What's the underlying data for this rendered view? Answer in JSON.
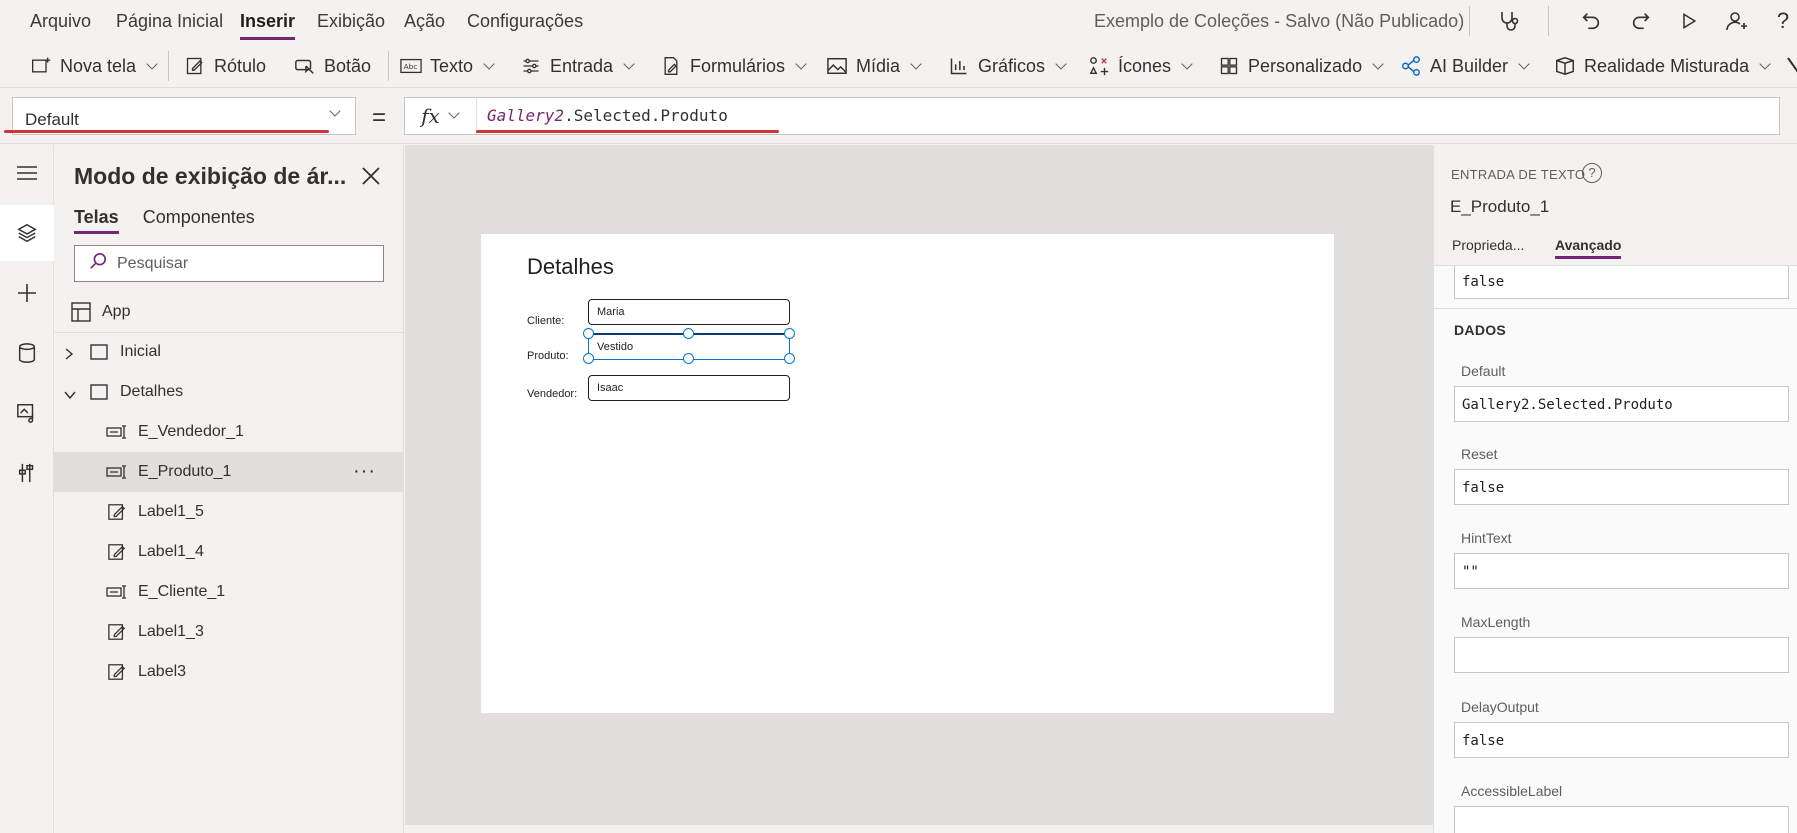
{
  "menubar": {
    "items": [
      "Arquivo",
      "Página Inicial",
      "Inserir",
      "Exibição",
      "Ação",
      "Configurações"
    ],
    "active": "Inserir",
    "app_title": "Exemplo de Coleções - Salvo (Não Publicado)",
    "icons": [
      "stethoscope-icon",
      "undo-icon",
      "redo-icon",
      "play-icon",
      "share-user-icon",
      "help-icon"
    ]
  },
  "ribbon": {
    "items": [
      {
        "label": "Nova tela",
        "icon": "new-screen-icon",
        "dropdown": true
      },
      {
        "label": "Rótulo",
        "icon": "label-edit-icon",
        "dropdown": false
      },
      {
        "label": "Botão",
        "icon": "button-icon",
        "dropdown": false
      },
      {
        "label": "Texto",
        "icon": "text-icon",
        "dropdown": true
      },
      {
        "label": "Entrada",
        "icon": "input-sliders-icon",
        "dropdown": true
      },
      {
        "label": "Formulários",
        "icon": "form-icon",
        "dropdown": true
      },
      {
        "label": "Mídia",
        "icon": "image-icon",
        "dropdown": true
      },
      {
        "label": "Gráficos",
        "icon": "chart-icon",
        "dropdown": true
      },
      {
        "label": "Ícones",
        "icon": "icons-icon",
        "dropdown": true
      },
      {
        "label": "Personalizado",
        "icon": "custom-grid-icon",
        "dropdown": true
      },
      {
        "label": "AI Builder",
        "icon": "ai-builder-icon",
        "dropdown": true
      },
      {
        "label": "Realidade Misturada",
        "icon": "mixed-reality-icon",
        "dropdown": true
      }
    ]
  },
  "formula_bar": {
    "property": "Default",
    "equals": "=",
    "fx": "fx",
    "formula_control": "Gallery2",
    "formula_rest": ".Selected.Produto"
  },
  "tree": {
    "title": "Modo de exibição de ár...",
    "tabs": [
      "Telas",
      "Componentes"
    ],
    "active_tab": "Telas",
    "search_placeholder": "Pesquisar",
    "app_label": "App",
    "screens": [
      {
        "label": "Inicial",
        "expanded": false
      },
      {
        "label": "Detalhes",
        "expanded": true
      }
    ],
    "controls": [
      {
        "label": "E_Vendedor_1",
        "icon": "text-input-icon",
        "selected": false
      },
      {
        "label": "E_Produto_1",
        "icon": "text-input-icon",
        "selected": true
      },
      {
        "label": "Label1_5",
        "icon": "label-edit-icon",
        "selected": false
      },
      {
        "label": "Label1_4",
        "icon": "label-edit-icon",
        "selected": false
      },
      {
        "label": "E_Cliente_1",
        "icon": "text-input-icon",
        "selected": false
      },
      {
        "label": "Label1_3",
        "icon": "label-edit-icon",
        "selected": false
      },
      {
        "label": "Label3",
        "icon": "label-edit-icon",
        "selected": false
      }
    ],
    "more": "···"
  },
  "canvas": {
    "title": "Detalhes",
    "fields": [
      {
        "label": "Cliente:",
        "value": "Maria"
      },
      {
        "label": "Produto:",
        "value": "Vestido"
      },
      {
        "label": "Vendedor:",
        "value": "Isaac"
      }
    ]
  },
  "properties": {
    "kind": "ENTRADA DE TEXTO",
    "help": "?",
    "name": "E_Produto_1",
    "tabs": [
      "Proprieda...",
      "Avançado"
    ],
    "active_tab": "Avançado",
    "top_value": "false",
    "section": "DADOS",
    "fields": [
      {
        "label": "Default",
        "value": "Gallery2.Selected.Produto"
      },
      {
        "label": "Reset",
        "value": "false"
      },
      {
        "label": "HintText",
        "value": "\"\""
      },
      {
        "label": "MaxLength",
        "value": ""
      },
      {
        "label": "DelayOutput",
        "value": "false"
      },
      {
        "label": "AccessibleLabel",
        "value": ""
      }
    ]
  },
  "colors": {
    "accent": "#742774",
    "selection": "#0078d4",
    "annotation_red": "#d13438"
  }
}
